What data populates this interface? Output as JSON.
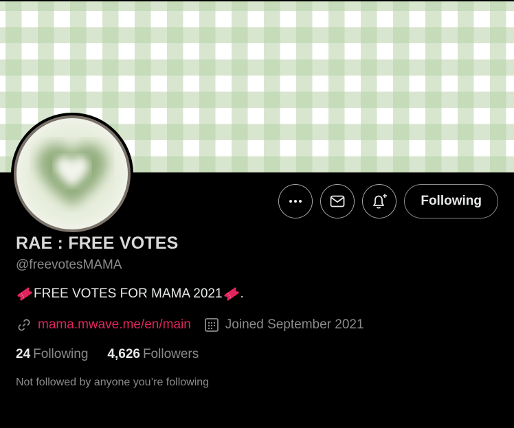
{
  "profile": {
    "display_name": "RAE : FREE VOTES",
    "handle": "@freevotesMAMA",
    "bio_text": "FREE VOTES FOR MAMA 2021",
    "bio_suffix": ".",
    "website": "mama.mwave.me/en/main",
    "joined": "Joined September 2021",
    "following_count": "24",
    "following_label": "Following",
    "followers_count": "4,626",
    "followers_label": "Followers",
    "followed_note": "Not followed by anyone you’re following"
  },
  "actions": {
    "more_icon": "more-horizontal-icon",
    "message_icon": "envelope-icon",
    "notify_icon": "bell-plus-icon",
    "follow_label": "Following"
  },
  "colors": {
    "background": "#000000",
    "link": "#e0245e",
    "banner_green": "#b7d2a8"
  }
}
